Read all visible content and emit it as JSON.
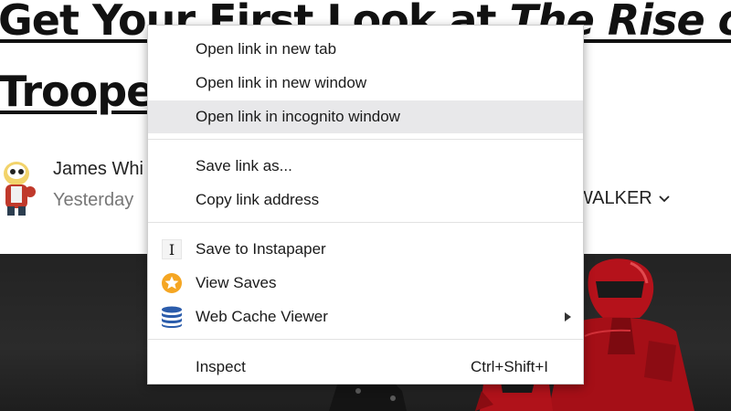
{
  "article": {
    "headline_line1_start": "Get Your First Look at ",
    "headline_line1_italic": "The Rise of",
    "headline_line2": "Trooper",
    "author_name": "James Whi",
    "post_date": "Yesterday",
    "tag_link": "WALKER"
  },
  "context_menu": {
    "items": [
      {
        "label": "Open link in new tab"
      },
      {
        "label": "Open link in new window"
      },
      {
        "label": "Open link in incognito window",
        "highlighted": true
      },
      {
        "label": "Save link as..."
      },
      {
        "label": "Copy link address"
      },
      {
        "label": "Save to Instapaper",
        "icon": "instapaper-icon"
      },
      {
        "label": "View Saves",
        "icon": "star-badge-icon"
      },
      {
        "label": "Web Cache Viewer",
        "icon": "database-icon",
        "has_submenu": true
      },
      {
        "label": "Inspect",
        "shortcut": "Ctrl+Shift+I"
      }
    ]
  },
  "colors": {
    "highlight": "#e8e8ea",
    "star_badge": "#f5a623",
    "database": "#2b5cab"
  }
}
